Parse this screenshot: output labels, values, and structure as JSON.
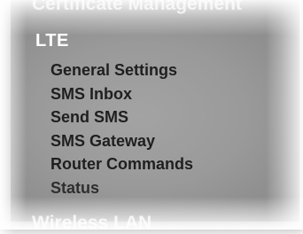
{
  "menu": {
    "prev_section_label": "Certificate Management",
    "section_title": "LTE",
    "items": [
      {
        "label": "General Settings"
      },
      {
        "label": "SMS Inbox"
      },
      {
        "label": "Send SMS"
      },
      {
        "label": "SMS Gateway"
      },
      {
        "label": "Router Commands"
      },
      {
        "label": "Status"
      }
    ],
    "next_section_label": "Wireless LAN"
  },
  "colors": {
    "panel_background": "#9a9a9a",
    "section_title_text": "#ffffff",
    "item_text": "#1f1f1f"
  }
}
